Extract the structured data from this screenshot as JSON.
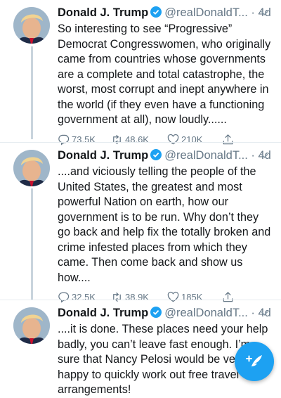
{
  "tweets": [
    {
      "name": "Donald J. Trump",
      "handle": "@realDonaldT...",
      "time": "· 4d",
      "text": "So interesting to see “Progressive”\nDemocrat Congresswomen, who originally\ncame from countries whose governments\nare a complete and total catastrophe, the\nworst, most corrupt and inept anywhere in\nthe world (if they even have a functioning\ngovernment at all), now loudly......",
      "replies": "73.5K",
      "retweets": "48.6K",
      "likes": "210K"
    },
    {
      "name": "Donald J. Trump",
      "handle": "@realDonaldT...",
      "time": "· 4d",
      "text": "....and viciously telling the people of the\nUnited States, the greatest and most\npowerful Nation on earth, how our\ngovernment is to be run. Why don’t they\ngo back and help fix the totally broken and\ncrime infested places from which they\ncame. Then come back and show us\nhow....",
      "replies": "32.5K",
      "retweets": "38.9K",
      "likes": "185K"
    },
    {
      "name": "Donald J. Trump",
      "handle": "@realDonaldT...",
      "time": "· 4d",
      "text": "....it is done. These places need your help\nbadly, you can’t leave fast enough. I’m\nsure that Nancy Pelosi would be very\nhappy to quickly work out free travel\narrangements!"
    }
  ],
  "colors": {
    "accent": "#1da1f2",
    "muted": "#657786",
    "thread_line": "#c9d4dd"
  },
  "icons": [
    "verified-badge-icon",
    "chevron-down-icon",
    "reply-icon",
    "retweet-icon",
    "like-icon",
    "share-icon",
    "compose-tweet-icon"
  ]
}
